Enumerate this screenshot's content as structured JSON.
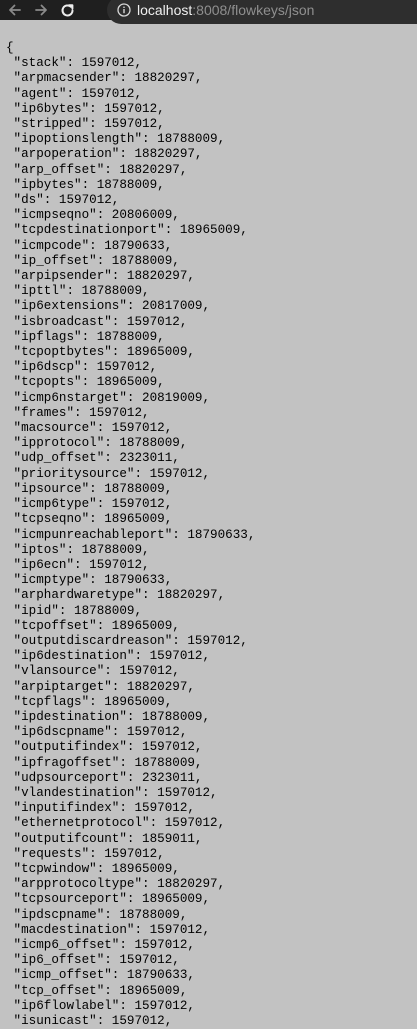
{
  "browser": {
    "back_icon": "back-arrow-icon",
    "forward_icon": "forward-arrow-icon",
    "reload_icon": "reload-icon",
    "info_icon": "info-icon",
    "url_host": "localhost",
    "url_rest": ":8008/flowkeys/json"
  },
  "json_lines": [
    "{",
    " \"stack\": 1597012,",
    " \"arpmacsender\": 18820297,",
    " \"agent\": 1597012,",
    " \"ip6bytes\": 1597012,",
    " \"stripped\": 1597012,",
    " \"ipoptionslength\": 18788009,",
    " \"arpoperation\": 18820297,",
    " \"arp_offset\": 18820297,",
    " \"ipbytes\": 18788009,",
    " \"ds\": 1597012,",
    " \"icmpseqno\": 20806009,",
    " \"tcpdestinationport\": 18965009,",
    " \"icmpcode\": 18790633,",
    " \"ip_offset\": 18788009,",
    " \"arpipsender\": 18820297,",
    " \"ipttl\": 18788009,",
    " \"ip6extensions\": 20817009,",
    " \"isbroadcast\": 1597012,",
    " \"ipflags\": 18788009,",
    " \"tcpoptbytes\": 18965009,",
    " \"ip6dscp\": 1597012,",
    " \"tcpopts\": 18965009,",
    " \"icmp6nstarget\": 20819009,",
    " \"frames\": 1597012,",
    " \"macsource\": 1597012,",
    " \"ipprotocol\": 18788009,",
    " \"udp_offset\": 2323011,",
    " \"prioritysource\": 1597012,",
    " \"ipsource\": 18788009,",
    " \"icmp6type\": 1597012,",
    " \"tcpseqno\": 18965009,",
    " \"icmpunreachableport\": 18790633,",
    " \"iptos\": 18788009,",
    " \"ip6ecn\": 1597012,",
    " \"icmptype\": 18790633,",
    " \"arphardwaretype\": 18820297,",
    " \"ipid\": 18788009,",
    " \"tcpoffset\": 18965009,",
    " \"outputdiscardreason\": 1597012,",
    " \"ip6destination\": 1597012,",
    " \"vlansource\": 1597012,",
    " \"arpiptarget\": 18820297,",
    " \"tcpflags\": 18965009,",
    " \"ipdestination\": 18788009,",
    " \"ip6dscpname\": 1597012,",
    " \"outputifindex\": 1597012,",
    " \"ipfragoffset\": 18788009,",
    " \"udpsourceport\": 2323011,",
    " \"vlandestination\": 1597012,",
    " \"inputifindex\": 1597012,",
    " \"ethernetprotocol\": 1597012,",
    " \"outputifcount\": 1859011,",
    " \"requests\": 1597012,",
    " \"tcpwindow\": 18965009,",
    " \"arpprotocoltype\": 18820297,",
    " \"tcpsourceport\": 18965009,",
    " \"ipdscpname\": 18788009,",
    " \"macdestination\": 1597012,",
    " \"icmp6_offset\": 1597012,",
    " \"ip6_offset\": 1597012,",
    " \"icmp_offset\": 18790633,",
    " \"tcp_offset\": 18965009,",
    " \"ip6flowlabel\": 1597012,",
    " \"isunicast\": 1597012,"
  ]
}
